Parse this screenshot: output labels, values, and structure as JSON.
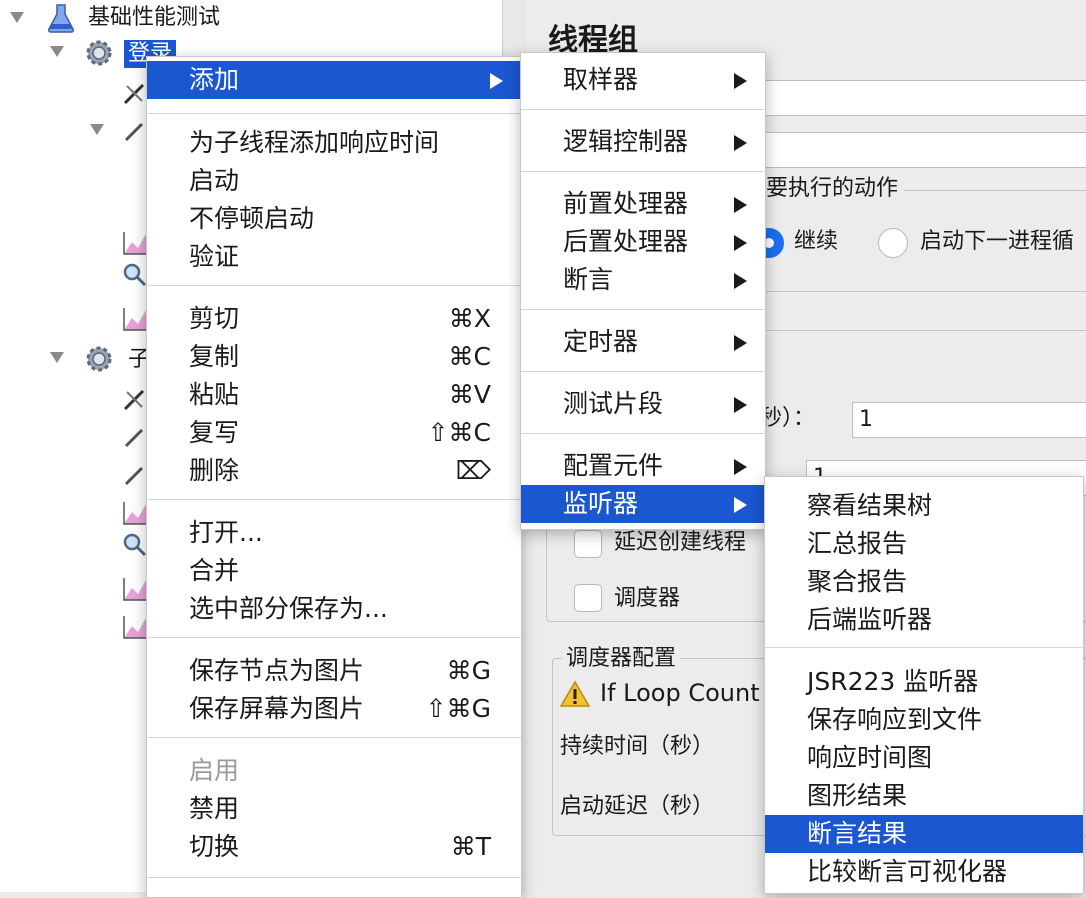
{
  "tree": {
    "root_label": "基础性能测试",
    "group1_label": "登录",
    "group2_label": "子"
  },
  "panel": {
    "title": "线程组",
    "action_group_label": "要执行的动作",
    "radio_continue": "继续",
    "radio_next_loop": "启动下一进程循",
    "ramp_label": "秒）：",
    "ramp_value": "1",
    "loop_label": "1",
    "delay_create_label": "延迟创建线程",
    "scheduler_label": "调度器",
    "scheduler_config_title": "调度器配置",
    "warning_text": "If Loop Count",
    "duration_label": "持续时间（秒）",
    "startup_delay_label": "启动延迟（秒）"
  },
  "context_menu": {
    "items": [
      {
        "label": "添加",
        "highlighted": true,
        "submenu": true
      },
      {
        "label": "为子线程添加响应时间"
      },
      {
        "label": "启动"
      },
      {
        "label": "不停顿启动"
      },
      {
        "label": "验证"
      },
      {
        "label": "剪切",
        "shortcut": "⌘X"
      },
      {
        "label": "复制",
        "shortcut": "⌘C"
      },
      {
        "label": "粘贴",
        "shortcut": "⌘V"
      },
      {
        "label": "复写",
        "shortcut": "⇧⌘C"
      },
      {
        "label": "删除",
        "shortcut": "⌦"
      },
      {
        "label": "打开..."
      },
      {
        "label": "合并"
      },
      {
        "label": "选中部分保存为..."
      },
      {
        "label": "保存节点为图片",
        "shortcut": "⌘G"
      },
      {
        "label": "保存屏幕为图片",
        "shortcut": "⇧⌘G"
      },
      {
        "label": "启用",
        "disabled": true
      },
      {
        "label": "禁用"
      },
      {
        "label": "切换",
        "shortcut": "⌘T"
      }
    ]
  },
  "add_submenu": {
    "items": [
      {
        "label": "取样器"
      },
      {
        "label": "逻辑控制器"
      },
      {
        "label": "前置处理器"
      },
      {
        "label": "后置处理器"
      },
      {
        "label": "断言"
      },
      {
        "label": "定时器"
      },
      {
        "label": "测试片段"
      },
      {
        "label": "配置元件"
      },
      {
        "label": "监听器",
        "highlighted": true
      }
    ]
  },
  "listener_submenu": {
    "items": [
      {
        "label": "察看结果树"
      },
      {
        "label": "汇总报告"
      },
      {
        "label": "聚合报告"
      },
      {
        "label": "后端监听器"
      },
      {
        "label": "JSR223 监听器"
      },
      {
        "label": "保存响应到文件"
      },
      {
        "label": "响应时间图"
      },
      {
        "label": "图形结果"
      },
      {
        "label": "断言结果",
        "highlighted": true
      },
      {
        "label": "比较断言可视化器"
      }
    ]
  },
  "colors": {
    "highlight": "#1b57d1",
    "radio_on": "#1b6ef3"
  }
}
